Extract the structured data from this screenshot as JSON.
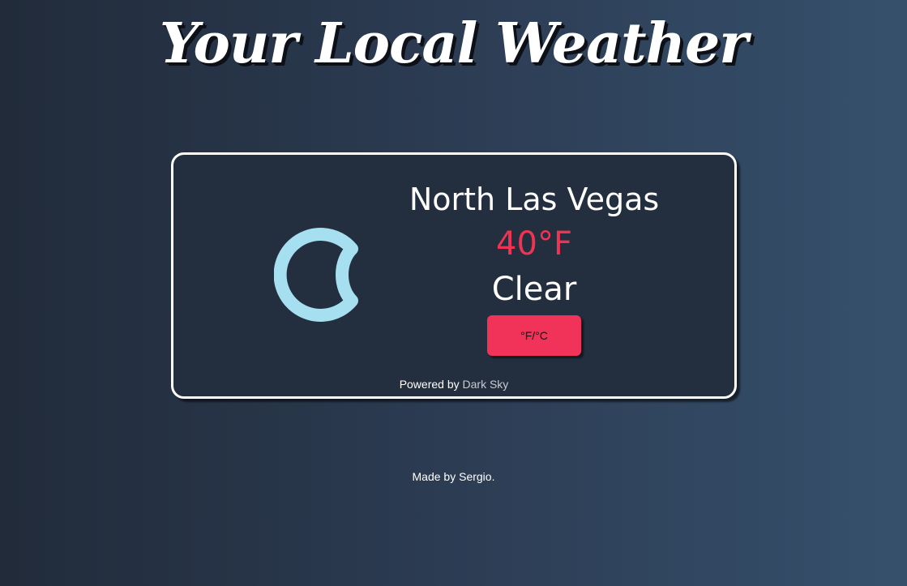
{
  "header": {
    "title": "Your Local Weather"
  },
  "weather": {
    "location": "North Las Vegas",
    "temperature": "40°F",
    "condition": "Clear",
    "icon": "moon-icon",
    "toggle_label": "°F/°C"
  },
  "attribution": {
    "prefix": "Powered by",
    "link_text": "Dark Sky"
  },
  "footer": {
    "credit": "Made by Sergio."
  },
  "colors": {
    "accent": "#f1335a",
    "temperature": "#f03352",
    "icon": "#a5dff0",
    "card_background": "#232e3f"
  }
}
